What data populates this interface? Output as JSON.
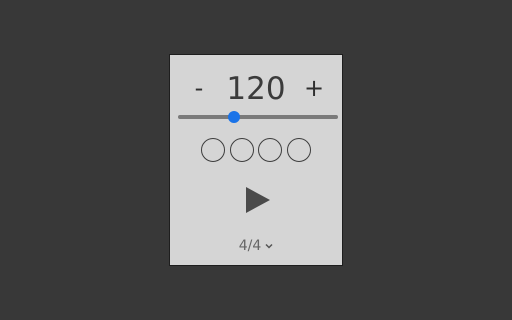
{
  "metronome": {
    "tempo": "120",
    "decrement_label": "-",
    "increment_label": "+",
    "tempo_slider_fraction": 0.35,
    "beats": [
      {
        "active": false
      },
      {
        "active": false
      },
      {
        "active": false
      },
      {
        "active": false
      }
    ],
    "play_icon": "play-icon",
    "time_signature": "4/4",
    "dropdown_icon": "chevron-down-icon"
  },
  "colors": {
    "background": "#383838",
    "panel": "#d5d5d5",
    "accent": "#1a73e8",
    "text": "#3b3b3b",
    "track": "#7a7a7a"
  }
}
